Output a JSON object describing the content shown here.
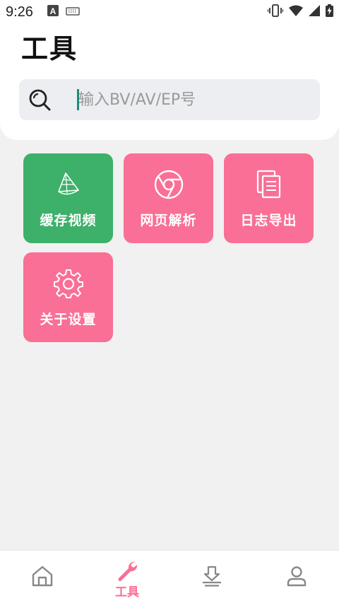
{
  "status_bar": {
    "time": "9:26",
    "left_icons": [
      "a-notification-icon",
      "keyboard-icon"
    ],
    "right_icons": [
      "vibrate-icon",
      "wifi-icon",
      "signal-icon",
      "battery-charging-icon"
    ]
  },
  "header": {
    "title": "工具"
  },
  "search": {
    "placeholder": "输入BV/AV/EP号",
    "value": ""
  },
  "tools": [
    {
      "label": "缓存视频",
      "icon": "zongzi-icon",
      "color": "#3db06a"
    },
    {
      "label": "网页解析",
      "icon": "browser-icon",
      "color": "#f96f95"
    },
    {
      "label": "日志导出",
      "icon": "documents-icon",
      "color": "#f96f95"
    },
    {
      "label": "关于设置",
      "icon": "gear-icon",
      "color": "#f96f95"
    }
  ],
  "bottom_nav": {
    "items": [
      {
        "icon": "home-icon",
        "label": ""
      },
      {
        "icon": "wrench-icon",
        "label": "工具",
        "active": true
      },
      {
        "icon": "download-icon",
        "label": ""
      },
      {
        "icon": "profile-icon",
        "label": ""
      }
    ],
    "active_color": "#f96f95",
    "inactive_color": "#888888"
  }
}
